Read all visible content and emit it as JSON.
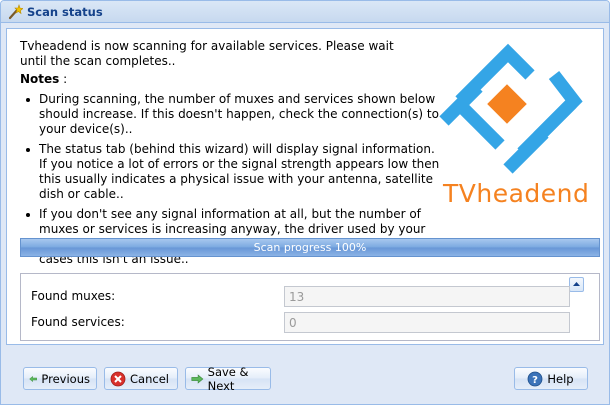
{
  "window": {
    "title": "Scan status",
    "icon": "wizard-wand-icon"
  },
  "intro": "Tvheadend is now scanning for available services. Please wait until the scan completes..",
  "notes": {
    "heading": "Notes",
    "heading_suffix": " :",
    "items": [
      "During scanning, the number of muxes and services shown below should increase. If this doesn't happen, check the connection(s) to your device(s)..",
      "The status tab (behind this wizard) will display signal information. If you notice a lot of errors or the signal strength appears low then this usually indicates a physical issue with your antenna, satellite dish or cable..",
      "If you don't see any signal information at all, but the number of muxes or services is increasing anyway, the driver used by your device isn't supplying signal information to Tvheadend. In most cases this isn't an issue.."
    ]
  },
  "logo": {
    "text": "TVheadend",
    "colors": {
      "blue": "#34a5e6",
      "orange": "#f58220"
    }
  },
  "progress": {
    "label": "Scan progress 100%",
    "value_percent": 100
  },
  "fields": {
    "muxes": {
      "label": "Found muxes:",
      "value": "13"
    },
    "services": {
      "label": "Found services:",
      "value": "0"
    }
  },
  "buttons": {
    "previous": "Previous",
    "cancel": "Cancel",
    "save_next": "Save & Next",
    "help": "Help"
  }
}
